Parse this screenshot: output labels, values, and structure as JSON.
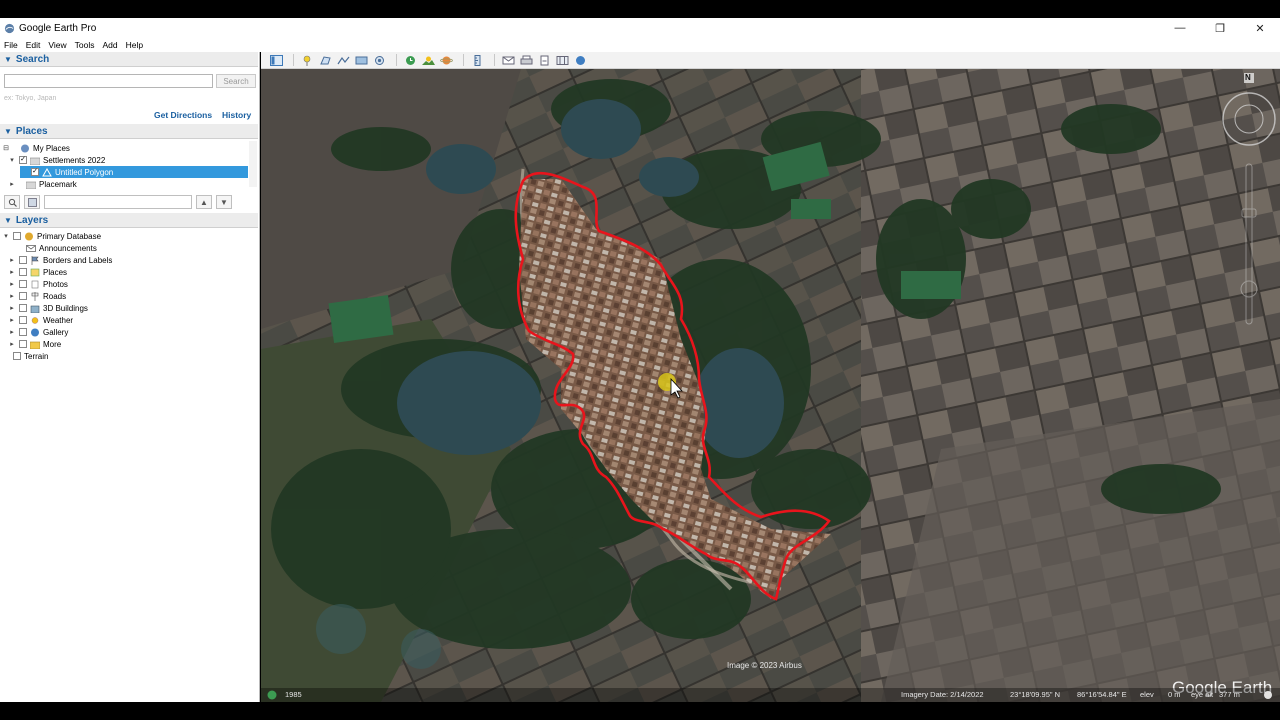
{
  "window": {
    "title": "Google Earth Pro",
    "minimize_glyph": "—",
    "restore_glyph": "❐",
    "close_glyph": "✕"
  },
  "menu": [
    "File",
    "Edit",
    "View",
    "Tools",
    "Add",
    "Help"
  ],
  "search": {
    "header": "Search",
    "placeholder": "",
    "button_label": "Search",
    "hint": "ex: Tokyo, Japan",
    "get_directions": "Get Directions",
    "history": "History"
  },
  "places": {
    "header": "Places",
    "items": [
      {
        "label": "My Places"
      },
      {
        "label": "Settlements 2022"
      },
      {
        "label": "Untitled Polygon"
      },
      {
        "label": "Placemark"
      }
    ]
  },
  "layers": {
    "header": "Layers",
    "items": [
      {
        "label": "Primary Database"
      },
      {
        "label": "Announcements"
      },
      {
        "label": "Borders and Labels"
      },
      {
        "label": "Places"
      },
      {
        "label": "Photos"
      },
      {
        "label": "Roads"
      },
      {
        "label": "3D Buildings"
      },
      {
        "label": "Weather"
      },
      {
        "label": "Gallery"
      },
      {
        "label": "More"
      },
      {
        "label": "Terrain"
      }
    ]
  },
  "map": {
    "attribution": "Image © 2023 Airbus",
    "watermark": "Google Earth",
    "year": "1985",
    "imagery_date": "Imagery Date: 2/14/2022",
    "lat": "23°18'09.95\" N",
    "lon": "86°16'54.84\" E",
    "elev": "elev",
    "elev_value": "0 m",
    "eye_alt_label": "eye alt",
    "eye_alt_value": "377 m",
    "compass_letter": "N"
  },
  "colors": {
    "accent_blue": "#1a5fa0",
    "selection": "#3399dd",
    "polygon": "#e8141c"
  }
}
